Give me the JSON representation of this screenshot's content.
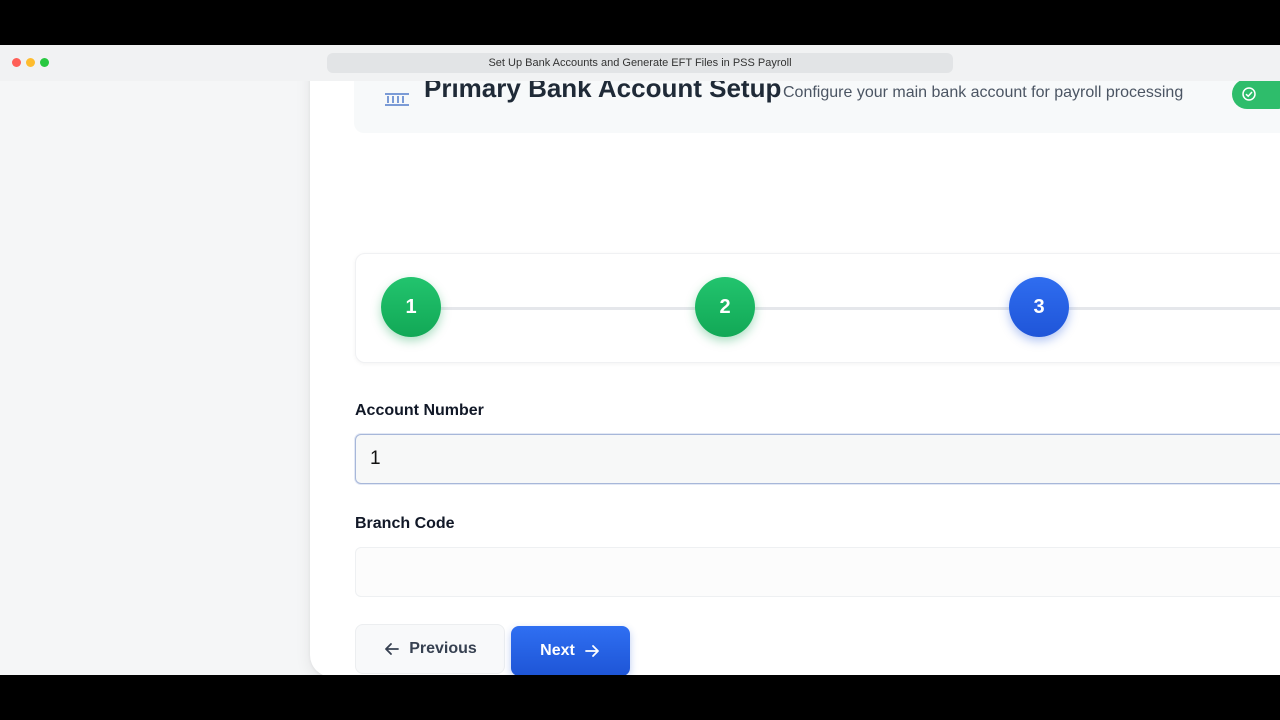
{
  "browser": {
    "tab_title": "Set Up Bank Accounts and Generate EFT Files in PSS Payroll"
  },
  "header": {
    "title": "Primary Bank Account Setup",
    "subtitle": "Configure your main bank account for payroll processing",
    "icon": "bank-icon",
    "status_icon": "check-circle-icon"
  },
  "stepper": {
    "steps": [
      {
        "label": "1",
        "state": "complete"
      },
      {
        "label": "2",
        "state": "complete"
      },
      {
        "label": "3",
        "state": "current"
      }
    ]
  },
  "form": {
    "account_number": {
      "label": "Account Number",
      "value": "1"
    },
    "branch_code": {
      "label": "Branch Code",
      "value": ""
    }
  },
  "buttons": {
    "previous": "Previous",
    "next": "Next"
  },
  "colors": {
    "complete_step": "#16b35f",
    "current_step": "#2563eb",
    "primary_button": "#2563eb"
  }
}
